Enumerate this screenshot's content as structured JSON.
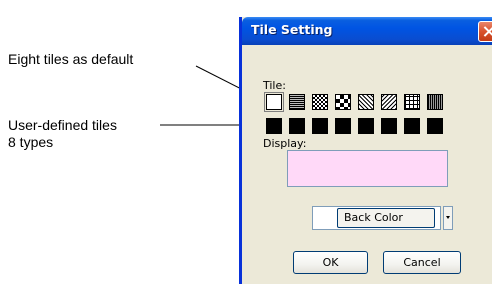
{
  "annotations": {
    "eight_tiles": "Eight tiles as default",
    "user_defined_line1": "User-defined tiles",
    "user_defined_line2": "8 types"
  },
  "dialog": {
    "title": "Tile Setting",
    "tile_label": "Tile:",
    "display_label": "Display:",
    "display_color": "#ffd9f8",
    "color_button_label": "Back Color",
    "ok_label": "OK",
    "cancel_label": "Cancel"
  },
  "colors": {
    "title_bar": "#0054e3",
    "dialog_face": "#ece9d8",
    "close_button": "#d9532e"
  },
  "icons": {
    "close": "close-icon",
    "dropdown": "chevron-down-icon"
  }
}
